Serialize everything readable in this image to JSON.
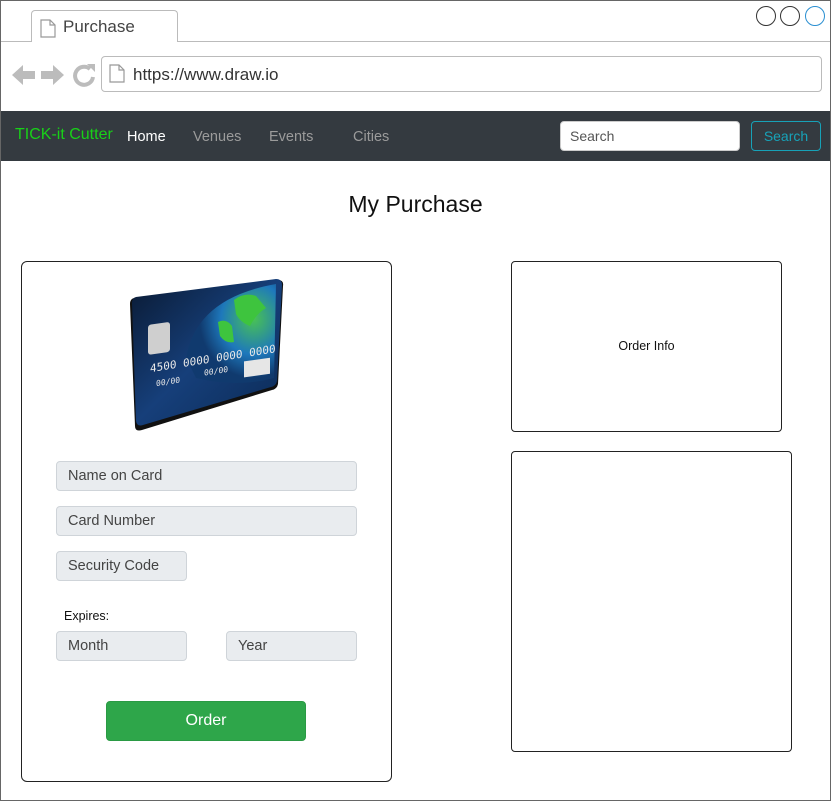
{
  "browser": {
    "tab_title": "Purchase",
    "url": "https://www.draw.io",
    "icons": [
      "back-arrow-icon",
      "forward-arrow-icon",
      "reload-icon",
      "document-icon"
    ]
  },
  "navbar": {
    "brand": "TICK-it Cutter",
    "links": [
      "Home",
      "Venues",
      "Events",
      "Cities"
    ],
    "active_link": "Home",
    "search_placeholder": "Search",
    "search_button": "Search",
    "colors": {
      "background": "#343a40",
      "brand": "#18d118",
      "search_accent": "#17a2b8"
    }
  },
  "main": {
    "title": "My Purchase",
    "payment_form": {
      "card_image": {
        "number": "4500 0000 0000 0000",
        "expiry": "00/00",
        "code": "00/00"
      },
      "fields": {
        "name_on_card": "Name on Card",
        "card_number": "Card Number",
        "security_code": "Security Code",
        "month": "Month",
        "year": "Year"
      },
      "expires_label": "Expires:",
      "order_button": "Order",
      "colors": {
        "order_button": "#2ea64a",
        "field_background": "#e9ecef"
      }
    },
    "order_info": {
      "label": "Order Info"
    }
  }
}
